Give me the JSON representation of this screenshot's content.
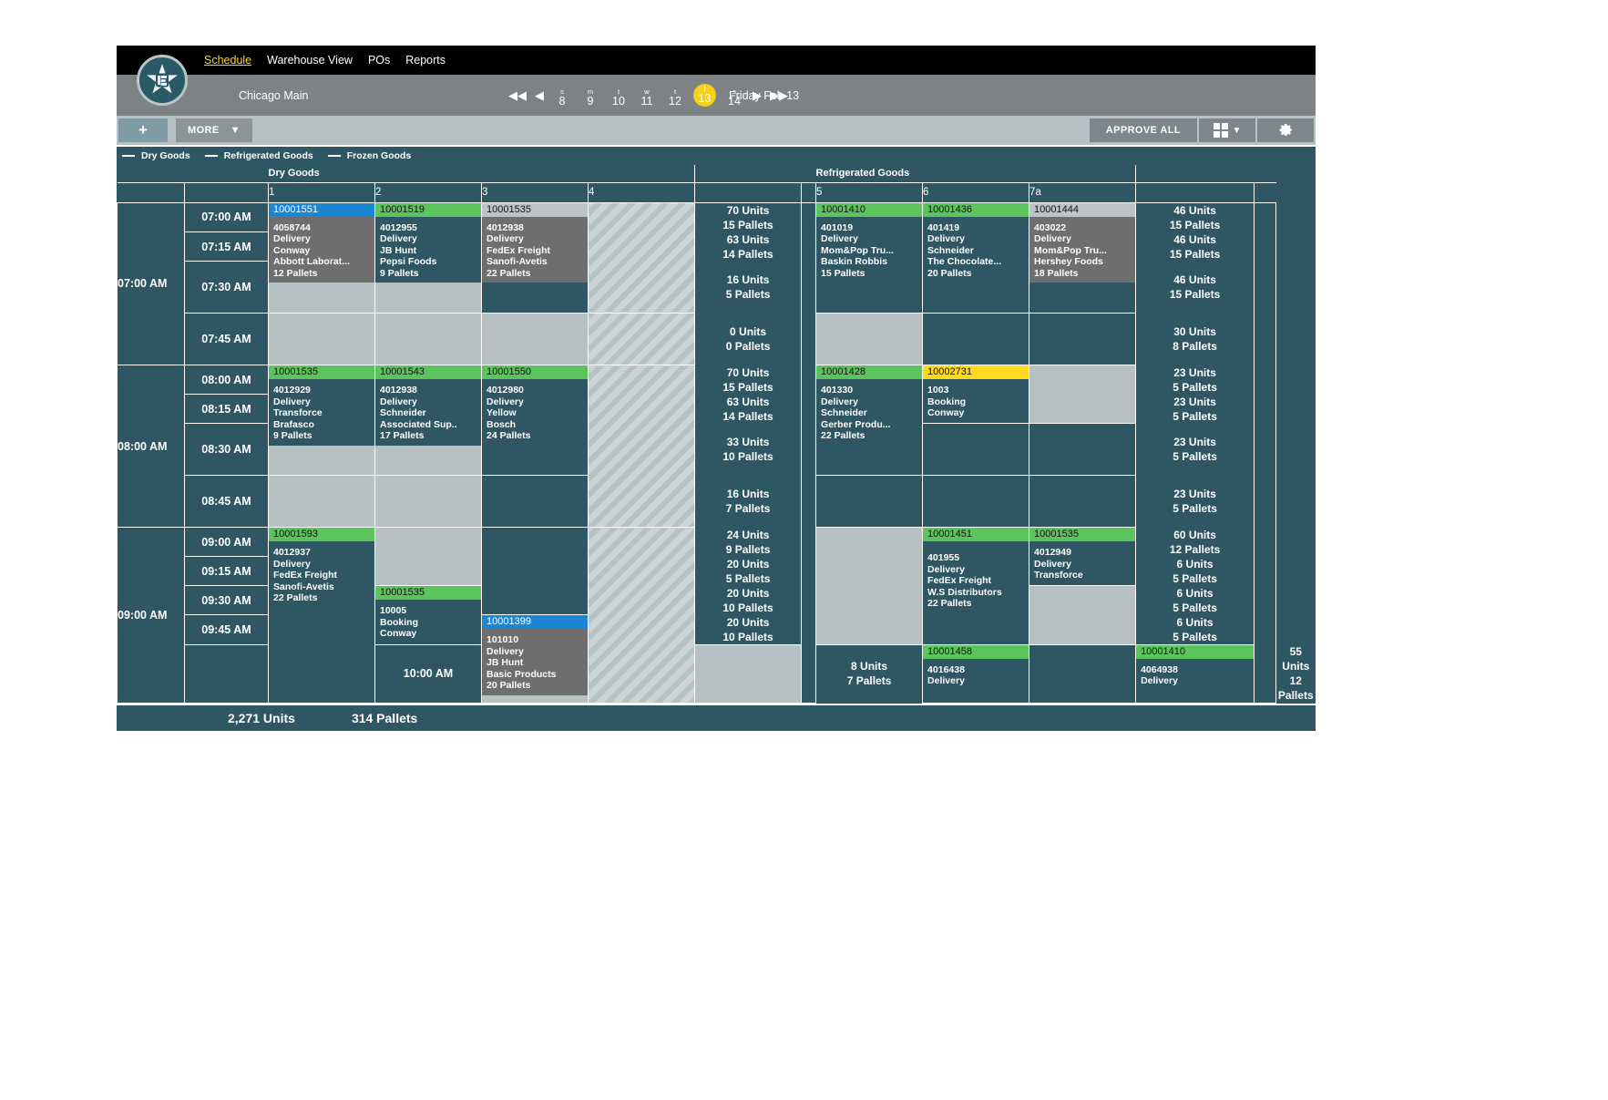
{
  "nav": {
    "links": [
      {
        "label": "Schedule",
        "active": true
      },
      {
        "label": "Warehouse View",
        "active": false
      },
      {
        "label": "POs",
        "active": false
      },
      {
        "label": "Reports",
        "active": false
      }
    ]
  },
  "locationbar": {
    "location": "Chicago Main",
    "weekday_label": "Friday Feb 13",
    "days": [
      {
        "dow": "s",
        "num": "8",
        "selected": false
      },
      {
        "dow": "m",
        "num": "9",
        "selected": false
      },
      {
        "dow": "t",
        "num": "10",
        "selected": false
      },
      {
        "dow": "w",
        "num": "11",
        "selected": false
      },
      {
        "dow": "t",
        "num": "12",
        "selected": false
      },
      {
        "dow": "f",
        "num": "13",
        "selected": true
      },
      {
        "dow": "s",
        "num": "14",
        "selected": false
      }
    ]
  },
  "toolbar": {
    "add_label": "+",
    "more_label": "MORE",
    "more_caret": "▼",
    "approve_label": "APPROVE ALL",
    "layout_caret": "▼",
    "gear_glyph": "⚙"
  },
  "legend": [
    {
      "label": "Dry Goods"
    },
    {
      "label": "Refrigerated Goods"
    },
    {
      "label": "Frozen Goods"
    }
  ],
  "groups": {
    "dry": "Dry Goods",
    "refrigerated": "Refrigerated Goods"
  },
  "docks": {
    "dry": [
      "1",
      "2",
      "3",
      "4"
    ],
    "refrigerated": [
      "5",
      "6",
      "7a"
    ]
  },
  "hours": [
    {
      "label": "07:00 AM"
    },
    {
      "label": "08:00 AM"
    },
    {
      "label": "09:00 AM"
    }
  ],
  "timeslots": [
    "07:00 AM",
    "07:15 AM",
    "07:30 AM",
    "07:45 AM",
    "08:00 AM",
    "08:15 AM",
    "08:30 AM",
    "08:45 AM",
    "09:00 AM",
    "09:15 AM",
    "09:30 AM",
    "09:45 AM",
    "10:00 AM"
  ],
  "units_column": [
    {
      "units": "70 Units",
      "pallets": "15 Pallets"
    },
    {
      "units": "63 Units",
      "pallets": "14 Pallets"
    },
    {
      "units": "16 Units",
      "pallets": "5 Pallets"
    },
    {
      "units": "0 Units",
      "pallets": "0 Pallets"
    },
    {
      "units": "70 Units",
      "pallets": "15 Pallets"
    },
    {
      "units": "63 Units",
      "pallets": "14 Pallets"
    },
    {
      "units": "33 Units",
      "pallets": "10 Pallets"
    },
    {
      "units": "16 Units",
      "pallets": "7 Pallets"
    },
    {
      "units": "24 Units",
      "pallets": "9 Pallets"
    },
    {
      "units": "20 Units",
      "pallets": "5 Pallets"
    },
    {
      "units": "20 Units",
      "pallets": "10 Pallets"
    },
    {
      "units": "20 Units",
      "pallets": "10 Pallets"
    },
    {
      "units": "8 Units",
      "pallets": "7 Pallets"
    }
  ],
  "totals_column": [
    {
      "units": "46 Units",
      "pallets": "15 Pallets"
    },
    {
      "units": "46 Units",
      "pallets": "15 Pallets"
    },
    {
      "units": "46 Units",
      "pallets": "15 Pallets"
    },
    {
      "units": "30 Units",
      "pallets": "8 Pallets"
    },
    {
      "units": "23 Units",
      "pallets": "5 Pallets"
    },
    {
      "units": "23 Units",
      "pallets": "5 Pallets"
    },
    {
      "units": "23 Units",
      "pallets": "5 Pallets"
    },
    {
      "units": "23 Units",
      "pallets": "5 Pallets"
    },
    {
      "units": "60 Units",
      "pallets": "12 Pallets"
    },
    {
      "units": "6 Units",
      "pallets": "5 Pallets"
    },
    {
      "units": "6 Units",
      "pallets": "5 Pallets"
    },
    {
      "units": "6 Units",
      "pallets": "5 Pallets"
    },
    {
      "units": "55 Units",
      "pallets": "12 Pallets"
    }
  ],
  "appointments": {
    "a1": {
      "id": "10001551",
      "order": "4058744",
      "type": "Delivery",
      "carrier": "Conway",
      "vendor": "Abbott Laborat...",
      "pallets": "12 Pallets",
      "color": "blue"
    },
    "a2": {
      "id": "10001519",
      "order": "4012955",
      "type": "Delivery",
      "carrier": "JB Hunt",
      "vendor": "Pepsi Foods",
      "pallets": "9 Pallets",
      "color": "green"
    },
    "a3": {
      "id": "10001535",
      "order": "4012938",
      "type": "Delivery",
      "carrier": "FedEx Freight",
      "vendor": "Sanofi-Avetis",
      "pallets": "22 Pallets",
      "color": "grey"
    },
    "a4": {
      "id": "10001410",
      "order": "401019",
      "type": "Delivery",
      "carrier": "Mom&Pop Tru...",
      "vendor": "Baskin Robbis",
      "pallets": "15 Pallets",
      "color": "green"
    },
    "a5": {
      "id": "10001436",
      "order": "401419",
      "type": "Delivery",
      "carrier": "Schneider",
      "vendor": "The Chocolate...",
      "pallets": "20 Pallets",
      "color": "green"
    },
    "a6": {
      "id": "10001444",
      "order": "403022",
      "type": "Delivery",
      "carrier": "Mom&Pop Tru...",
      "vendor": "Hershey Foods",
      "pallets": "18 Pallets",
      "color": "grey"
    },
    "a7": {
      "id": "10001535",
      "order": "4012929",
      "type": "Delivery",
      "carrier": "Transforce",
      "vendor": "Brafasco",
      "pallets": "9 Pallets",
      "color": "green"
    },
    "a8": {
      "id": "10001543",
      "order": "4012938",
      "type": "Delivery",
      "carrier": "Schneider",
      "vendor": "Associated Sup..",
      "pallets": "17 Pallets",
      "color": "green"
    },
    "a9": {
      "id": "10001550",
      "order": "4012980",
      "type": "Delivery",
      "carrier": "Yellow",
      "vendor": "Bosch",
      "pallets": "24 Pallets",
      "color": "green"
    },
    "a10": {
      "id": "10001428",
      "order": "401330",
      "type": "Delivery",
      "carrier": "Schneider",
      "vendor": "Gerber Produ...",
      "pallets": "22 Pallets",
      "color": "green"
    },
    "a11": {
      "id": "10002731",
      "order": "1003",
      "type": "Booking",
      "carrier": "Conway",
      "vendor": "",
      "pallets": "",
      "color": "yellow"
    },
    "a12": {
      "id": "10001593",
      "order": "4012937",
      "type": "Delivery",
      "carrier": "FedEx Freight",
      "vendor": "Sanofi-Avetis",
      "pallets": "22 Pallets",
      "color": "green"
    },
    "a13": {
      "id": "10001451",
      "order": "401955",
      "type": "Delivery",
      "carrier": "FedEx Freight",
      "vendor": "W.S Distributors",
      "pallets": "22 Pallets",
      "color": "green"
    },
    "a14": {
      "id": "10001535",
      "order": "4012949",
      "type": "Delivery",
      "carrier": "Transforce",
      "vendor": "",
      "pallets": "",
      "color": "green"
    },
    "a15": {
      "id": "10001535",
      "order": "10005",
      "type": "Booking",
      "carrier": "Conway",
      "vendor": "",
      "pallets": "",
      "color": "green"
    },
    "a16": {
      "id": "10001399",
      "order": "101010",
      "type": "Delivery",
      "carrier": "JB Hunt",
      "vendor": "Basic Products",
      "pallets": "20 Pallets",
      "color": "blue"
    },
    "a17": {
      "id": "10001458",
      "order": "4016438",
      "type": "Delivery",
      "carrier": "",
      "vendor": "",
      "pallets": "",
      "color": "green"
    },
    "a18": {
      "id": "10001410",
      "order": "4064938",
      "type": "Delivery",
      "carrier": "",
      "vendor": "",
      "pallets": "",
      "color": "green"
    }
  },
  "footer": {
    "units_total": "2,271 Units",
    "pallets_total": "314 Pallets"
  },
  "colors": {
    "panel_dark": "#2f5663",
    "panel_light": "#b6c1c3",
    "accent_green": "#5cc45c",
    "accent_blue": "#1c86d4",
    "accent_yellow": "#ffd91e",
    "accent_grey": "#bcc4c6",
    "card_grey": "#6e6e6e",
    "nav_highlight": "#ffd21e"
  }
}
